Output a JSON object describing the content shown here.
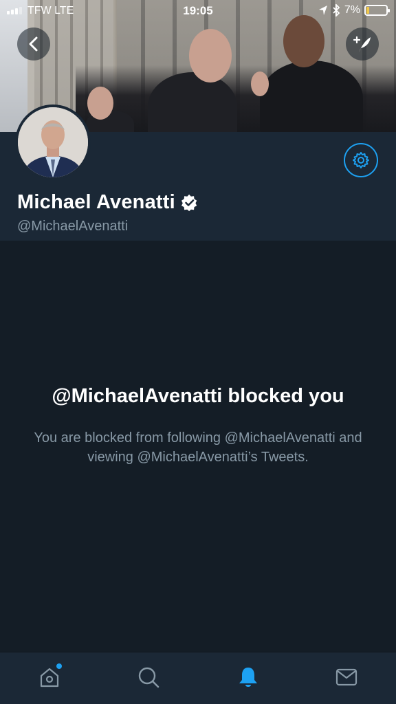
{
  "status_bar": {
    "carrier": "TFW  LTE",
    "time": "19:05",
    "battery_percent": "7%",
    "battery_level": 0.07
  },
  "profile": {
    "display_name": "Michael Avenatti",
    "handle": "@MichaelAvenatti",
    "verified": true
  },
  "blocked": {
    "title": "@MichaelAvenatti blocked you",
    "description": "You are blocked from following @MichaelAvenatti and viewing @MichaelAvenatti’s Tweets."
  },
  "tab_bar": {
    "items": [
      {
        "icon": "home-icon",
        "active": false,
        "has_notification_dot": true
      },
      {
        "icon": "search-icon",
        "active": false
      },
      {
        "icon": "bell-icon",
        "active": true
      },
      {
        "icon": "mail-icon",
        "active": false
      }
    ]
  },
  "colors": {
    "background": "#141d26",
    "panel": "#1b2836",
    "accent": "#1da1f2",
    "secondary_text": "#8899a6"
  }
}
